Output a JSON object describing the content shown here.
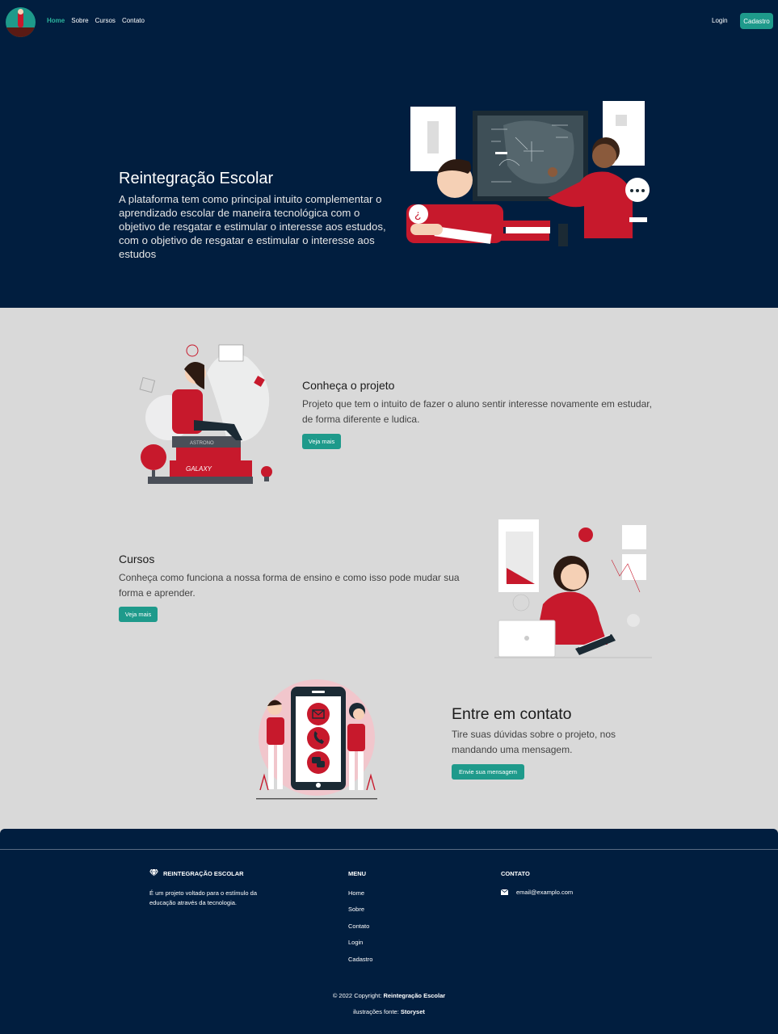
{
  "nav": {
    "links": [
      "Home",
      "Sobre",
      "Cursos",
      "Contato"
    ],
    "login": "Login",
    "register": "Cadastro"
  },
  "hero": {
    "title": "Reintegração Escolar",
    "text": "A plataforma tem como principal intuito complementar o aprendizado escolar de maneira tecnológica com o objetivo de resgatar e estimular o interesse aos estudos, com o objetivo de resgatar e estimular o interesse aos estudos"
  },
  "project": {
    "title": "Conheça o projeto",
    "text": "Projeto que tem o intuito de fazer o aluno sentir interesse novamente em estudar, de forma diferente e ludica.",
    "button": "Veja mais",
    "book_labels": [
      "ASTRONO",
      "GALAXY"
    ]
  },
  "courses": {
    "title": "Cursos",
    "text": "Conheça como funciona a nossa forma de ensino e como isso pode mudar sua forma e aprender.",
    "button": "Veja mais"
  },
  "contact": {
    "title": "Entre em contato",
    "text": "Tire suas dúvidas sobre o projeto, nos mandando uma mensagem.",
    "button": "Envie sua mensagem"
  },
  "footer": {
    "brand": "REINTEGRAÇÃO ESCOLAR",
    "brand_text": "É um projeto voltado para o estímulo da educação através da tecnologia.",
    "menu_title": "MENU",
    "menu": [
      "Home",
      "Sobre",
      "Contato",
      "Login",
      "Cadastro"
    ],
    "contact_title": "CONTATO",
    "email": "email@examplo.com",
    "copyright_prefix": "© 2022 Copyright: ",
    "copyright_name": "Reintegração Escolar",
    "source_prefix": "ilustrações fonte: ",
    "source_name": "Storyset"
  },
  "colors": {
    "navy": "#011e3f",
    "teal": "#1e9a8b",
    "red": "#c7192c",
    "gray": "#d9d9d9"
  }
}
